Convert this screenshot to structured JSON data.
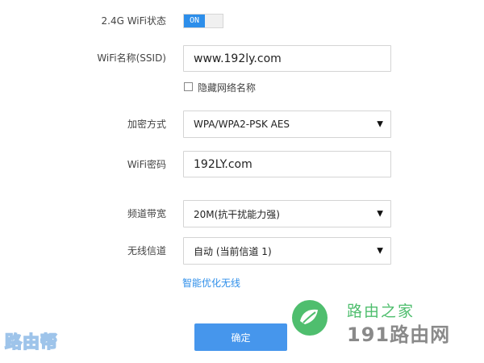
{
  "form": {
    "wifi_status": {
      "label": "2.4G WiFi状态",
      "toggle_text": "ON"
    },
    "ssid": {
      "label": "WiFi名称(SSID)",
      "value": "www.192ly.com"
    },
    "hide_network": {
      "label": "隐藏网络名称",
      "checked": false
    },
    "encryption": {
      "label": "加密方式",
      "value": "WPA/WPA2-PSK AES"
    },
    "password": {
      "label": "WiFi密码",
      "value": "192LY.com"
    },
    "bandwidth": {
      "label": "频道带宽",
      "value": "20M(抗干扰能力强)"
    },
    "channel": {
      "label": "无线信道",
      "value": "自动 (当前信道 1)"
    },
    "optimize_link": "智能优化无线",
    "confirm_button": "确定"
  },
  "watermarks": {
    "left": "路由帮",
    "right_top": "路由之家",
    "right_bottom": "191路由网"
  },
  "colors": {
    "accent": "#2d8eea",
    "button": "#4696ec",
    "border": "#d4d4d4",
    "logo_green": "#4fbe6e"
  },
  "icons": [
    "chevron-down-icon",
    "leaf-logo-icon"
  ]
}
